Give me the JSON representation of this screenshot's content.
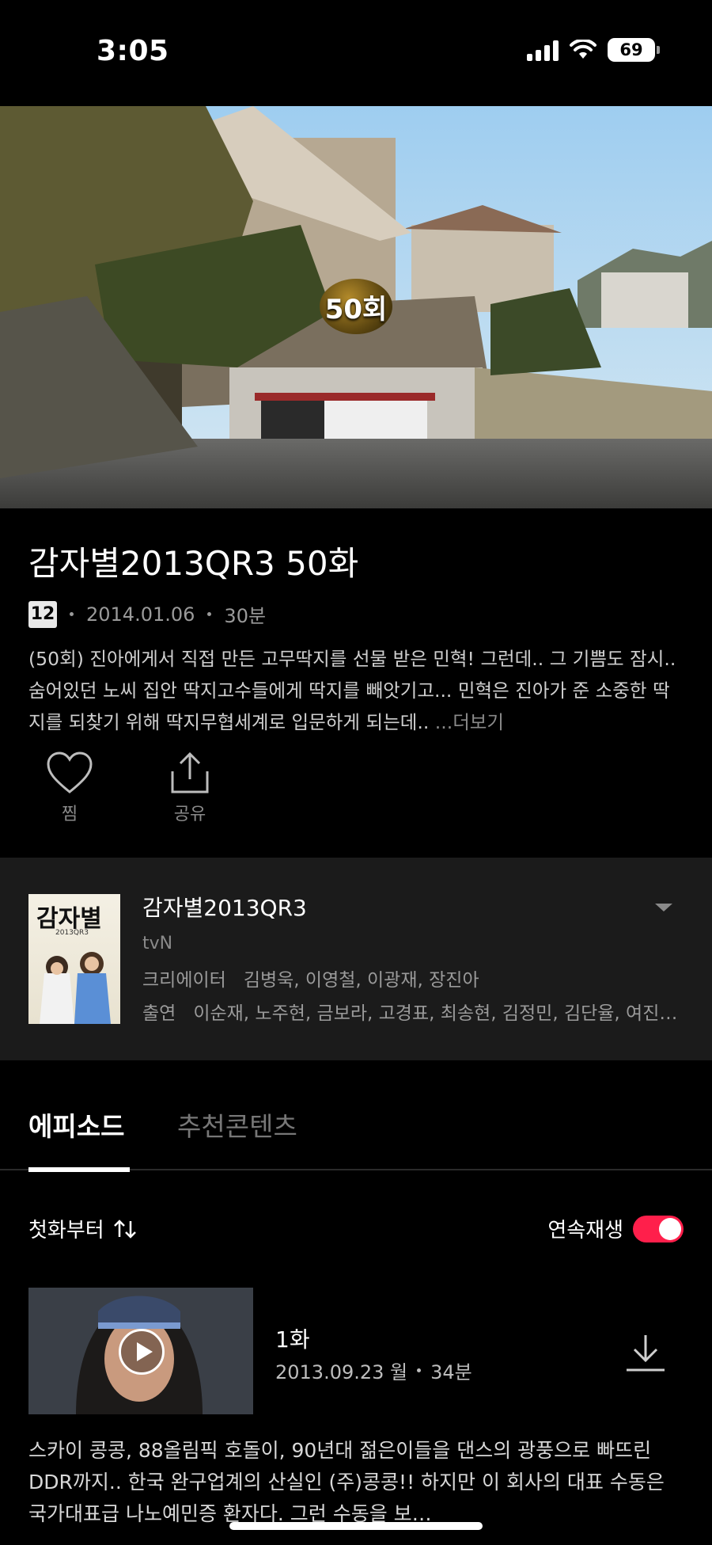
{
  "status_bar": {
    "time": "3:05",
    "battery": "69"
  },
  "hero": {
    "badge": "50회"
  },
  "episode": {
    "title": "감자별2013QR3 50화",
    "rating": "12",
    "date": "2014.01.06",
    "duration": "30분",
    "description": "(50회) 진아에게서 직접 만든 고무딱지를 선물 받은 민혁! 그런데.. 그 기쁨도 잠시.. 숨어있던 노씨 집안 딱지고수들에게 딱지를 빼앗기고... 민혁은 진아가 준 소중한 딱지를 되찾기 위해 딱지무협세계로 입문하게 되는데.. ",
    "more_label": "...더보기"
  },
  "actions": {
    "like_label": "찜",
    "share_label": "공유"
  },
  "program": {
    "poster_text": "감자별",
    "poster_sub": "2013QR3",
    "title": "감자별2013QR3",
    "network": "tvN",
    "creator_label": "크리에이터",
    "creators": "김병욱, 이영철, 이광재, 장진아",
    "cast_label": "출연",
    "cast": "이순재, 노주현, 금보라, 고경표, 최송현, 김정민, 김단율, 여진구, 서예지"
  },
  "tabs": {
    "episodes": "에피소드",
    "recommended": "추천콘텐츠"
  },
  "list_controls": {
    "sort_label": "첫화부터",
    "autoplay_label": "연속재생",
    "autoplay_on": true
  },
  "episodes": [
    {
      "name": "1화",
      "date": "2013.09.23 월",
      "duration": "34분",
      "description": "스카이 콩콩, 88올림픽 호돌이, 90년대 젊은이들을 댄스의 광풍으로 빠뜨린 DDR까지.. 한국 완구업계의 산실인 (주)콩콩!! 하지만 이 회사의 대표 수동은 국가대표급 나노예민증 환자다.  그런 수동을 보…"
    }
  ],
  "colors": {
    "accent": "#ff1f4b",
    "background": "#000000",
    "panel": "#1b1b1b"
  }
}
